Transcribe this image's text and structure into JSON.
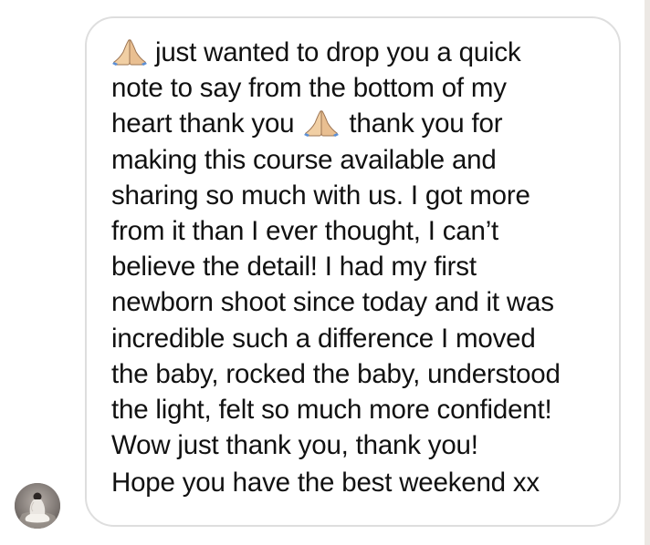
{
  "message": {
    "emoji": "folded-hands",
    "lines": [
      "just wanted to drop you a quick",
      "note to say from the bottom of my",
      "heart thank you",
      "thank you for",
      "making this course available and",
      "sharing so much with us. I got more",
      "from it than I ever thought, I can’t",
      "believe the detail! I had my first",
      "newborn shoot since today and it was",
      "incredible such a difference I moved",
      "the baby, rocked the baby, understood",
      "the light, felt so much more confident!",
      "Wow just thank you, thank you!",
      "Hope you have the best weekend xx"
    ]
  },
  "sender": {
    "avatar": "sender-avatar-photo"
  },
  "colors": {
    "bubble_border": "#dedede",
    "text": "#111111",
    "background": "#ffffff"
  }
}
